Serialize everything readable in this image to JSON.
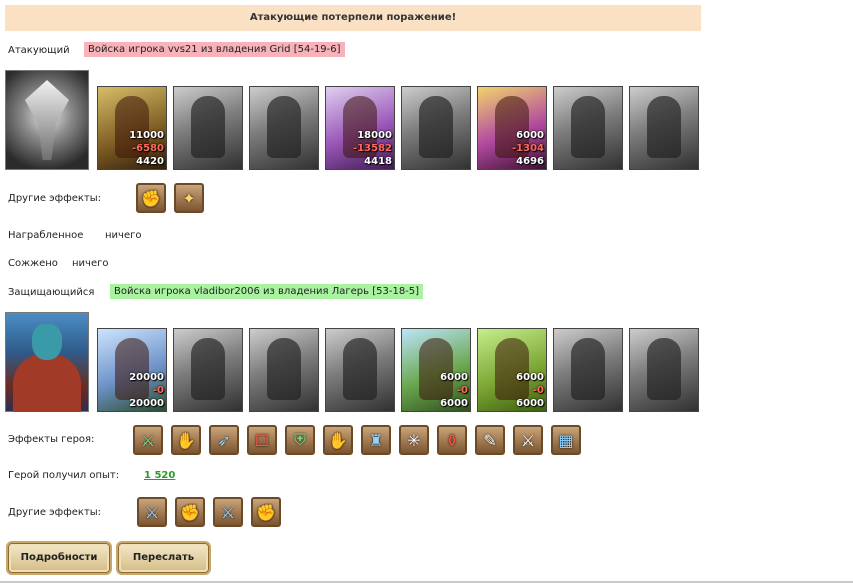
{
  "banner": "Атакующие потерпели поражение!",
  "attacker": {
    "label": "Атакующий",
    "owner": "Войска игрока vvs21 из владения Grid [54-19-6]",
    "units": [
      {
        "kind": "color",
        "total": "11000",
        "loss": "-6580",
        "left": "4420"
      },
      {
        "kind": "gray"
      },
      {
        "kind": "gray"
      },
      {
        "kind": "color",
        "total": "18000",
        "loss": "-13582",
        "left": "4418"
      },
      {
        "kind": "gray"
      },
      {
        "kind": "color",
        "total": "6000",
        "loss": "-1304",
        "left": "4696"
      },
      {
        "kind": "gray"
      },
      {
        "kind": "gray"
      }
    ],
    "other_effects_label": "Другие эффекты:",
    "other_effects": [
      "sword-fist-icon",
      "scroll-gold-icon"
    ]
  },
  "loot": {
    "label": "Награбленное",
    "value": "ничего"
  },
  "burned": {
    "label": "Сожжено",
    "value": "ничего"
  },
  "defender": {
    "label": "Защищающийся",
    "owner": "Войска игрока vladibor2006 из владения Лагерь [53-18-5]",
    "units": [
      {
        "kind": "color",
        "total": "20000",
        "loss": "-0",
        "left": "20000"
      },
      {
        "kind": "gray"
      },
      {
        "kind": "gray"
      },
      {
        "kind": "gray"
      },
      {
        "kind": "color",
        "total": "6000",
        "loss": "-0",
        "left": "6000"
      },
      {
        "kind": "color",
        "total": "6000",
        "loss": "-0",
        "left": "6000"
      },
      {
        "kind": "gray"
      },
      {
        "kind": "gray"
      }
    ],
    "hero_effects_label": "Эффекты героя:",
    "hero_effects": [
      "sword-icon",
      "handshake-icon",
      "feather-icon",
      "dice-icon",
      "shield-icon",
      "handshake-shield-icon",
      "armor-icon",
      "web-icon",
      "potion-icon",
      "scroll-icon",
      "blade-icon",
      "cage-icon"
    ],
    "experience_label": "Герой получил опыт:",
    "experience_value": "1 520",
    "other_effects_label": "Другие эффекты:",
    "other_effects": [
      "sword-icon",
      "sword-fist-icon",
      "sword-icon",
      "sword-fist-icon"
    ]
  },
  "buttons": {
    "details": "Подробности",
    "forward": "Переслать"
  }
}
